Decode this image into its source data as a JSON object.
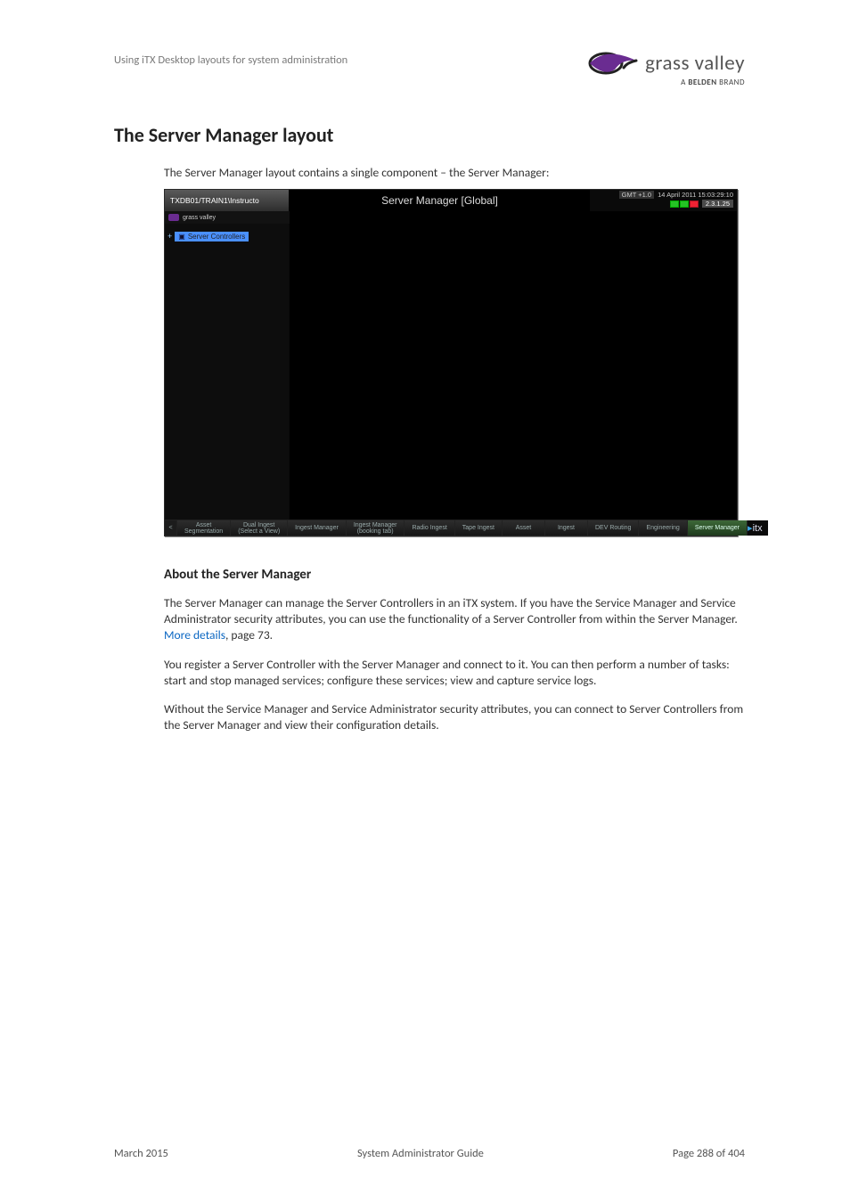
{
  "header": {
    "runningTitle": "Using iTX Desktop layouts for system administration",
    "logoText": "grass valley",
    "beldenPrefix": "A ",
    "beldenBold": "BELDEN",
    "beldenSuffix": " BRAND"
  },
  "title": "The Server Manager layout",
  "lead": "The Server Manager layout contains a single component – the Server Manager:",
  "screenshot": {
    "topLeft": "TXDB01/TRAIN1\\Instructo",
    "title": "Server Manager [Global]",
    "gmtLabel": "GMT +1.0",
    "dateTime": "14 April 2011 15:03:29:10",
    "version": "2.3.1.25",
    "gvBadge": "grass valley",
    "treeItem": "Server Controllers",
    "tabs": [
      "<",
      "Asset\nSegmentation",
      "Dual Ingest\n(Select a View)",
      "Ingest Manager",
      "Ingest Manager\n(booking tab)",
      "Radio Ingest",
      "Tape Ingest",
      "Asset",
      "Ingest",
      "DEV Routing",
      "Engineering",
      "Server Manager"
    ],
    "activeTab": 11,
    "itx": "itx"
  },
  "section": {
    "heading": "About the Server Manager",
    "p1a": "The Server Manager can manage the Server Controllers in an iTX system. If you have the Service Manager and Service Administrator security attributes, you can use the functionality of a Server Controller from within the Server Manager. ",
    "p1_link": "More details",
    "p1b": ", page 73.",
    "p2": "You register a Server Controller with the Server Manager and connect to it. You can then perform a number of tasks: start and stop managed services; configure these services; view and capture service logs.",
    "p3": "Without the Service Manager and Service Administrator security attributes, you can connect to Server Controllers from the Server Manager and view their configuration details."
  },
  "footer": {
    "left": "March 2015",
    "center": "System Administrator Guide",
    "right": "Page 288 of 404"
  }
}
